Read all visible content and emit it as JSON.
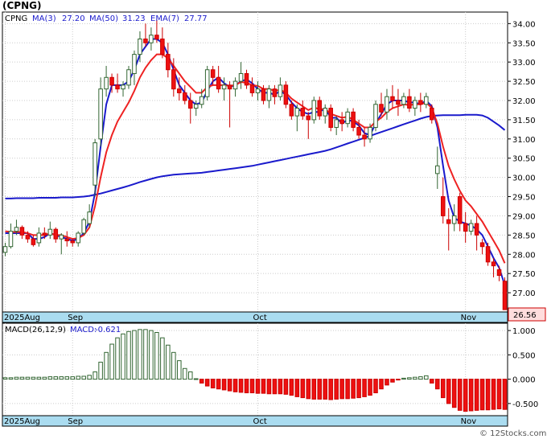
{
  "title": "(CPNG)",
  "copyright": "© 12Stocks.com",
  "chart_data": [
    {
      "type": "candlestick",
      "legend": {
        "symbol": "CPNG",
        "ma3": "MA(3)",
        "ma3_value": "27.20",
        "ma50": "MA(50)",
        "ma50_value": "31.23",
        "ema7": "EMA(7)",
        "ema7_value": "27.77"
      },
      "last_price": 26.56,
      "last_price_label": "26.56",
      "ylim": [
        26.5,
        34.3
      ],
      "yticks": [
        {
          "value": 27.0,
          "label": "27.00"
        },
        {
          "value": 27.5,
          "label": "27.50"
        },
        {
          "value": 28.0,
          "label": "28.00"
        },
        {
          "value": 28.5,
          "label": "28.50"
        },
        {
          "value": 29.0,
          "label": "29.00"
        },
        {
          "value": 29.5,
          "label": "29.50"
        },
        {
          "value": 30.0,
          "label": "30.00"
        },
        {
          "value": 30.5,
          "label": "30.50"
        },
        {
          "value": 31.0,
          "label": "31.00"
        },
        {
          "value": 31.5,
          "label": "31.50"
        },
        {
          "value": 32.0,
          "label": "32.00"
        },
        {
          "value": 32.5,
          "label": "32.50"
        },
        {
          "value": 33.0,
          "label": "33.00"
        },
        {
          "value": 33.5,
          "label": "33.50"
        },
        {
          "value": 34.0,
          "label": "34.00"
        }
      ],
      "xticks": [
        {
          "index": 0,
          "label": "2025Aug"
        },
        {
          "index": 12,
          "label": "Sep"
        },
        {
          "index": 45,
          "label": "Oct"
        },
        {
          "index": 82,
          "label": "Nov"
        }
      ],
      "candles": [
        [
          28.05,
          28.3,
          27.95,
          28.2
        ],
        [
          28.2,
          28.8,
          28.15,
          28.6
        ],
        [
          28.6,
          28.9,
          28.5,
          28.7
        ],
        [
          28.7,
          28.75,
          28.4,
          28.5
        ],
        [
          28.5,
          28.6,
          28.3,
          28.4
        ],
        [
          28.4,
          28.5,
          28.2,
          28.25
        ],
        [
          28.3,
          28.7,
          28.2,
          28.55
        ],
        [
          28.55,
          28.7,
          28.4,
          28.5
        ],
        [
          28.5,
          28.85,
          28.4,
          28.65
        ],
        [
          28.65,
          28.7,
          28.3,
          28.4
        ],
        [
          28.4,
          28.55,
          28.0,
          28.5
        ],
        [
          28.4,
          28.6,
          28.2,
          28.35
        ],
        [
          28.35,
          28.4,
          28.2,
          28.3
        ],
        [
          28.3,
          28.6,
          28.2,
          28.55
        ],
        [
          28.55,
          28.95,
          28.5,
          28.9
        ],
        [
          28.8,
          29.3,
          28.7,
          29.1
        ],
        [
          29.8,
          31.0,
          29.5,
          30.9
        ],
        [
          31.0,
          32.6,
          30.8,
          32.3
        ],
        [
          32.3,
          32.9,
          32.1,
          32.6
        ],
        [
          32.6,
          32.7,
          32.2,
          32.4
        ],
        [
          32.4,
          32.7,
          32.2,
          32.3
        ],
        [
          32.3,
          32.5,
          32.1,
          32.4
        ],
        [
          32.4,
          32.9,
          32.3,
          32.8
        ],
        [
          32.7,
          33.3,
          32.4,
          33.2
        ],
        [
          33.2,
          33.8,
          33.0,
          33.6
        ],
        [
          33.6,
          34.0,
          33.4,
          33.5
        ],
        [
          33.5,
          33.9,
          33.3,
          33.7
        ],
        [
          33.7,
          34.1,
          33.5,
          33.6
        ],
        [
          33.6,
          33.9,
          33.1,
          33.2
        ],
        [
          33.2,
          33.5,
          32.6,
          32.8
        ],
        [
          32.8,
          33.1,
          32.1,
          32.3
        ],
        [
          32.3,
          32.6,
          32.0,
          32.2
        ],
        [
          32.2,
          32.4,
          31.9,
          32.0
        ],
        [
          32.0,
          32.2,
          31.4,
          31.8
        ],
        [
          31.8,
          32.0,
          31.6,
          31.9
        ],
        [
          31.9,
          32.3,
          31.8,
          32.1
        ],
        [
          32.1,
          32.9,
          32.0,
          32.8
        ],
        [
          32.8,
          32.9,
          32.4,
          32.6
        ],
        [
          32.6,
          32.9,
          32.2,
          32.3
        ],
        [
          32.3,
          32.6,
          32.0,
          32.4
        ],
        [
          32.4,
          32.5,
          31.3,
          32.3
        ],
        [
          32.3,
          32.6,
          32.1,
          32.5
        ],
        [
          32.5,
          33.0,
          32.3,
          32.7
        ],
        [
          32.7,
          32.8,
          32.3,
          32.4
        ],
        [
          32.4,
          32.6,
          32.1,
          32.2
        ],
        [
          32.2,
          32.5,
          32.0,
          32.3
        ],
        [
          32.3,
          32.4,
          31.9,
          32.0
        ],
        [
          32.0,
          32.4,
          31.8,
          32.3
        ],
        [
          32.3,
          32.4,
          31.9,
          32.1
        ],
        [
          32.1,
          32.6,
          32.0,
          32.4
        ],
        [
          32.4,
          32.5,
          31.8,
          31.9
        ],
        [
          31.9,
          32.0,
          31.5,
          31.6
        ],
        [
          31.6,
          31.9,
          31.2,
          31.8
        ],
        [
          31.8,
          32.0,
          31.5,
          31.6
        ],
        [
          31.6,
          31.7,
          31.0,
          31.5
        ],
        [
          31.5,
          32.1,
          31.4,
          32.0
        ],
        [
          32.0,
          32.1,
          31.5,
          31.6
        ],
        [
          31.6,
          31.9,
          31.4,
          31.8
        ],
        [
          31.8,
          31.9,
          31.2,
          31.3
        ],
        [
          31.3,
          31.6,
          31.1,
          31.5
        ],
        [
          31.5,
          31.7,
          31.2,
          31.4
        ],
        [
          31.4,
          31.8,
          31.3,
          31.7
        ],
        [
          31.7,
          31.8,
          31.2,
          31.3
        ],
        [
          31.3,
          31.5,
          31.0,
          31.1
        ],
        [
          31.1,
          31.3,
          30.8,
          31.0
        ],
        [
          31.0,
          31.4,
          30.9,
          31.3
        ],
        [
          31.3,
          32.0,
          31.2,
          31.9
        ],
        [
          31.9,
          32.2,
          31.6,
          31.7
        ],
        [
          31.7,
          32.3,
          31.5,
          32.1
        ],
        [
          32.1,
          32.4,
          31.8,
          32.0
        ],
        [
          32.0,
          32.3,
          31.6,
          31.9
        ],
        [
          31.9,
          32.2,
          31.8,
          32.1
        ],
        [
          32.1,
          32.3,
          31.7,
          31.8
        ],
        [
          31.8,
          32.1,
          31.6,
          32.0
        ],
        [
          32.0,
          32.2,
          31.7,
          31.9
        ],
        [
          31.9,
          32.2,
          31.8,
          32.1
        ],
        [
          31.8,
          31.9,
          31.4,
          31.5
        ],
        [
          30.1,
          30.8,
          29.7,
          30.3
        ],
        [
          29.5,
          30.0,
          28.8,
          29.0
        ],
        [
          28.9,
          29.2,
          28.1,
          28.8
        ],
        [
          28.8,
          29.3,
          28.6,
          29.0
        ],
        [
          29.5,
          29.6,
          28.6,
          28.8
        ],
        [
          28.8,
          29.1,
          28.3,
          28.6
        ],
        [
          28.6,
          28.9,
          28.5,
          28.8
        ],
        [
          28.8,
          29.0,
          28.1,
          28.5
        ],
        [
          28.3,
          28.4,
          28.0,
          28.2
        ],
        [
          28.2,
          28.3,
          27.7,
          27.8
        ],
        [
          27.8,
          27.9,
          27.4,
          27.7
        ],
        [
          27.6,
          27.7,
          27.3,
          27.45
        ],
        [
          27.3,
          27.4,
          26.6,
          26.56
        ]
      ],
      "series": [
        {
          "name": "MA(3)",
          "color": "#1a1acc",
          "values": [
            28.55,
            28.55,
            28.55,
            28.55,
            28.55,
            28.4,
            28.4,
            28.45,
            28.55,
            28.5,
            28.45,
            28.4,
            28.35,
            28.4,
            28.55,
            28.85,
            29.6,
            30.8,
            31.9,
            32.4,
            32.4,
            32.4,
            32.5,
            32.8,
            33.2,
            33.4,
            33.6,
            33.6,
            33.5,
            33.2,
            32.8,
            32.4,
            32.2,
            32.0,
            31.9,
            31.95,
            32.25,
            32.5,
            32.6,
            32.45,
            32.35,
            32.4,
            32.5,
            32.55,
            32.45,
            32.3,
            32.2,
            32.2,
            32.15,
            32.25,
            32.15,
            31.95,
            31.8,
            31.7,
            31.65,
            31.7,
            31.7,
            31.8,
            31.55,
            31.55,
            31.4,
            31.5,
            31.45,
            31.35,
            31.15,
            31.1,
            31.4,
            31.65,
            31.9,
            32.0,
            32.0,
            32.0,
            31.95,
            31.95,
            31.9,
            32.0,
            31.85,
            31.3,
            30.3,
            29.4,
            28.95,
            28.85,
            28.8,
            28.75,
            28.65,
            28.5,
            28.2,
            27.9,
            27.65,
            27.2
          ]
        },
        {
          "name": "MA(50)",
          "color": "#1a1acc",
          "values": [
            29.45,
            29.45,
            29.46,
            29.46,
            29.46,
            29.46,
            29.47,
            29.47,
            29.47,
            29.47,
            29.48,
            29.48,
            29.48,
            29.49,
            29.5,
            29.52,
            29.55,
            29.58,
            29.62,
            29.66,
            29.7,
            29.74,
            29.78,
            29.83,
            29.88,
            29.92,
            29.96,
            30.0,
            30.03,
            30.05,
            30.07,
            30.08,
            30.09,
            30.1,
            30.11,
            30.12,
            30.14,
            30.16,
            30.18,
            30.2,
            30.22,
            30.24,
            30.26,
            30.28,
            30.3,
            30.33,
            30.36,
            30.39,
            30.42,
            30.45,
            30.48,
            30.51,
            30.54,
            30.57,
            30.6,
            30.63,
            30.66,
            30.69,
            30.73,
            30.78,
            30.83,
            30.88,
            30.93,
            30.98,
            31.03,
            31.08,
            31.13,
            31.18,
            31.23,
            31.28,
            31.33,
            31.38,
            31.43,
            31.48,
            31.53,
            31.57,
            31.6,
            31.61,
            31.62,
            31.62,
            31.62,
            31.62,
            31.63,
            31.63,
            31.63,
            31.61,
            31.55,
            31.45,
            31.35,
            31.23
          ]
        },
        {
          "name": "EMA(7)",
          "color": "#ee2222",
          "values": [
            28.6,
            28.58,
            28.58,
            28.58,
            28.55,
            28.5,
            28.5,
            28.5,
            28.55,
            28.5,
            28.5,
            28.45,
            28.4,
            28.42,
            28.5,
            28.7,
            29.25,
            30.0,
            30.65,
            31.1,
            31.45,
            31.7,
            31.95,
            32.25,
            32.6,
            32.85,
            33.05,
            33.2,
            33.2,
            33.1,
            32.9,
            32.7,
            32.5,
            32.35,
            32.2,
            32.2,
            32.35,
            32.4,
            32.4,
            32.4,
            32.38,
            32.4,
            32.48,
            32.46,
            32.4,
            32.38,
            32.3,
            32.3,
            32.25,
            32.28,
            32.2,
            32.05,
            31.95,
            31.85,
            31.75,
            31.82,
            31.77,
            31.78,
            31.65,
            31.6,
            31.55,
            31.58,
            31.5,
            31.4,
            31.3,
            31.3,
            31.45,
            31.55,
            31.7,
            31.8,
            31.85,
            31.9,
            31.88,
            31.9,
            31.9,
            31.95,
            31.8,
            31.4,
            30.8,
            30.3,
            29.95,
            29.65,
            29.4,
            29.25,
            29.05,
            28.85,
            28.6,
            28.35,
            28.1,
            27.77
          ]
        }
      ]
    },
    {
      "type": "bar",
      "legend": {
        "label": "MACD(26,12,9)",
        "macd": "MACD:",
        "macd_value": "-0.621"
      },
      "ylim": [
        -0.75,
        1.15
      ],
      "yticks": [
        {
          "value": 1.0,
          "label": "1.000"
        },
        {
          "value": 0.5,
          "label": "0.500"
        },
        {
          "value": 0.0,
          "label": "0.000"
        },
        {
          "value": -0.5,
          "label": "-0.500"
        }
      ],
      "xticks": [
        {
          "index": 0,
          "label": "2025Aug"
        },
        {
          "index": 12,
          "label": "Sep"
        },
        {
          "index": 45,
          "label": "Oct"
        },
        {
          "index": 82,
          "label": "Nov"
        }
      ],
      "values": [
        0.03,
        0.03,
        0.04,
        0.04,
        0.04,
        0.04,
        0.04,
        0.04,
        0.05,
        0.05,
        0.05,
        0.05,
        0.05,
        0.06,
        0.06,
        0.08,
        0.15,
        0.35,
        0.55,
        0.72,
        0.85,
        0.93,
        0.98,
        1.0,
        1.02,
        1.02,
        1.0,
        0.96,
        0.85,
        0.7,
        0.55,
        0.38,
        0.22,
        0.15,
        0.01,
        -0.08,
        -0.14,
        -0.18,
        -0.2,
        -0.22,
        -0.24,
        -0.26,
        -0.27,
        -0.28,
        -0.28,
        -0.29,
        -0.29,
        -0.3,
        -0.3,
        -0.3,
        -0.31,
        -0.33,
        -0.36,
        -0.38,
        -0.4,
        -0.41,
        -0.41,
        -0.41,
        -0.42,
        -0.41,
        -0.4,
        -0.4,
        -0.39,
        -0.38,
        -0.36,
        -0.33,
        -0.28,
        -0.2,
        -0.12,
        -0.06,
        -0.01,
        0.02,
        0.03,
        0.04,
        0.05,
        0.07,
        -0.08,
        -0.2,
        -0.38,
        -0.5,
        -0.58,
        -0.64,
        -0.66,
        -0.65,
        -0.64,
        -0.63,
        -0.63,
        -0.62,
        -0.61,
        -0.621
      ]
    }
  ]
}
